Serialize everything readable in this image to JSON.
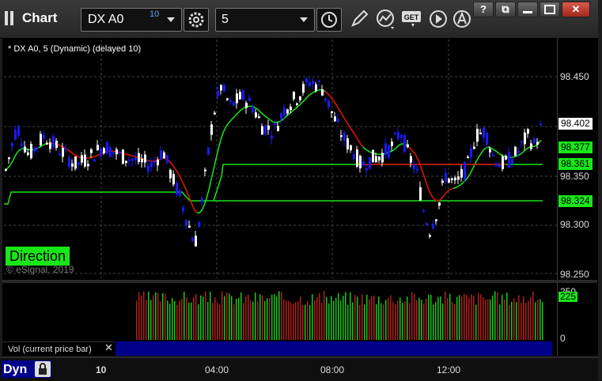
{
  "window": {
    "title": "Chart"
  },
  "toolbar": {
    "symbol": "DX A0",
    "symbol_badge": "10",
    "interval": "5",
    "icons": [
      "settings-icon",
      "clock-icon",
      "draw-icon",
      "study-icon",
      "get-icon",
      "play-icon",
      "alert-icon"
    ],
    "get_label": "GET"
  },
  "window_buttons": {
    "help": "?",
    "restore": "⧉",
    "minimize": "▭",
    "close": "✕"
  },
  "chart": {
    "study_label": "* DX A0, 5 (Dynamic) (delayed 10)",
    "direction_label": "Direction",
    "copyright": "© eSignal, 2019",
    "price_ticks": [
      "98.450",
      "98.350",
      "98.300",
      "98.250"
    ],
    "flags": {
      "last_price": "98.402",
      "green_upper": "98.377",
      "green_mid": "98.361",
      "green_lower": "98.324"
    },
    "volume_ticks": [
      "250",
      "0"
    ],
    "volume_flag": "225",
    "volume_label": "Vol (current price bar)",
    "volume_close": "✕",
    "time_labels": [
      "04:00",
      "08:00",
      "12:00"
    ],
    "date_label": "10",
    "dyn_label": "Dyn",
    "colors": {
      "up": "#ffffff",
      "down": "#1a1aff",
      "green": "#19e619",
      "red": "#e60000",
      "vol_up": "#19c819",
      "vol_down": "#b41e1e"
    }
  }
}
